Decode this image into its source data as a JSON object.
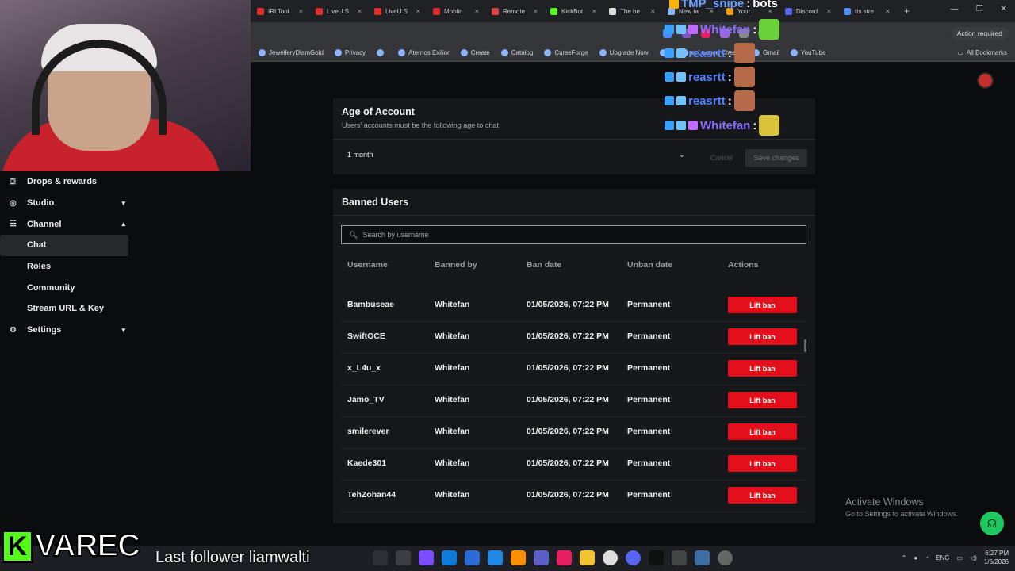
{
  "browser": {
    "tabs": [
      {
        "label": "IRLTool",
        "color": "#e22b2b"
      },
      {
        "label": "LiveU S",
        "color": "#e22b2b"
      },
      {
        "label": "LiveU S",
        "color": "#e22b2b"
      },
      {
        "label": "Moblin",
        "color": "#e22b2b"
      },
      {
        "label": "Remote",
        "color": "#d94343"
      },
      {
        "label": "KickBot",
        "color": "#53fc18"
      },
      {
        "label": "The be",
        "color": "#dddddd"
      },
      {
        "label": "New ta",
        "color": "#8ab4f8"
      },
      {
        "label": "Your",
        "color": "#f29900"
      },
      {
        "label": "Discord",
        "color": "#5865f2"
      },
      {
        "label": "tts stre",
        "color": "#4f8ef7"
      }
    ],
    "new_tab": "+",
    "action_required": "Action required",
    "bookmarks": [
      "JewelleryDiamGold",
      "Privacy",
      "",
      "Aternos Exilior",
      "Create",
      "Catalog",
      "CurseForge",
      "Upgrade Now",
      "",
      "et League Chea...",
      "Gmail",
      "YouTube"
    ],
    "all_bookmarks": "All Bookmarks"
  },
  "sidebar": {
    "items": [
      {
        "label": "Drops & rewards",
        "icon": "gift-icon",
        "chevron": ""
      },
      {
        "label": "Studio",
        "icon": "studio-icon",
        "chevron": "▾"
      },
      {
        "label": "Channel",
        "icon": "channel-icon",
        "chevron": "▴"
      }
    ],
    "channel_sub": [
      "Chat",
      "Roles",
      "Community",
      "Stream URL & Key"
    ],
    "settings": {
      "label": "Settings",
      "chevron": "▾"
    }
  },
  "age": {
    "title": "Age of Account",
    "subtitle": "Users' accounts must be the following age to chat",
    "selected": "1 month",
    "cancel": "Cancel",
    "save": "Save changes"
  },
  "banned": {
    "title": "Banned Users",
    "search_placeholder": "Search by username",
    "headers": [
      "Username",
      "Banned by",
      "Ban date",
      "Unban date",
      "Actions"
    ],
    "rows": [
      {
        "username": "Bambuseae",
        "by": "Whitefan",
        "date": "01/05/2026, 07:22 PM",
        "unban": "Permanent",
        "action": "Lift ban"
      },
      {
        "username": "SwiftOCE",
        "by": "Whitefan",
        "date": "01/05/2026, 07:22 PM",
        "unban": "Permanent",
        "action": "Lift ban"
      },
      {
        "username": "x_L4u_x",
        "by": "Whitefan",
        "date": "01/05/2026, 07:22 PM",
        "unban": "Permanent",
        "action": "Lift ban"
      },
      {
        "username": "Jamo_TV",
        "by": "Whitefan",
        "date": "01/05/2026, 07:22 PM",
        "unban": "Permanent",
        "action": "Lift ban"
      },
      {
        "username": "smilerever",
        "by": "Whitefan",
        "date": "01/05/2026, 07:22 PM",
        "unban": "Permanent",
        "action": "Lift ban"
      },
      {
        "username": "Kaede301",
        "by": "Whitefan",
        "date": "01/05/2026, 07:22 PM",
        "unban": "Permanent",
        "action": "Lift ban"
      },
      {
        "username": "TehZohan44",
        "by": "Whitefan",
        "date": "01/05/2026, 07:22 PM",
        "unban": "Permanent",
        "action": "Lift ban"
      }
    ]
  },
  "chat_overlay": [
    {
      "user": "TMP_snipe",
      "text": "bots",
      "color": "#6aa0ff"
    },
    {
      "user": "Whitefan",
      "text": "",
      "color": "#8a6cff"
    },
    {
      "user": "reasrtt",
      "text": "",
      "color": "#4f7dff"
    },
    {
      "user": "reasrtt",
      "text": "",
      "color": "#4f7dff"
    },
    {
      "user": "reasrtt",
      "text": "",
      "color": "#4f7dff"
    },
    {
      "user": "Whitefan",
      "text": "",
      "color": "#8a6cff"
    }
  ],
  "windows": {
    "line1": "Activate Windows",
    "line2": "Go to Settings to activate Windows."
  },
  "taskbar": {
    "lang": "ENG",
    "time": "6:27 PM",
    "date": "1/6/2026"
  },
  "stream": {
    "brand": "VAREC",
    "kick": "K",
    "follower": "Last follower liamwalti"
  },
  "colors": {
    "accent_red": "#e3101b",
    "kick_green": "#53fc18"
  }
}
